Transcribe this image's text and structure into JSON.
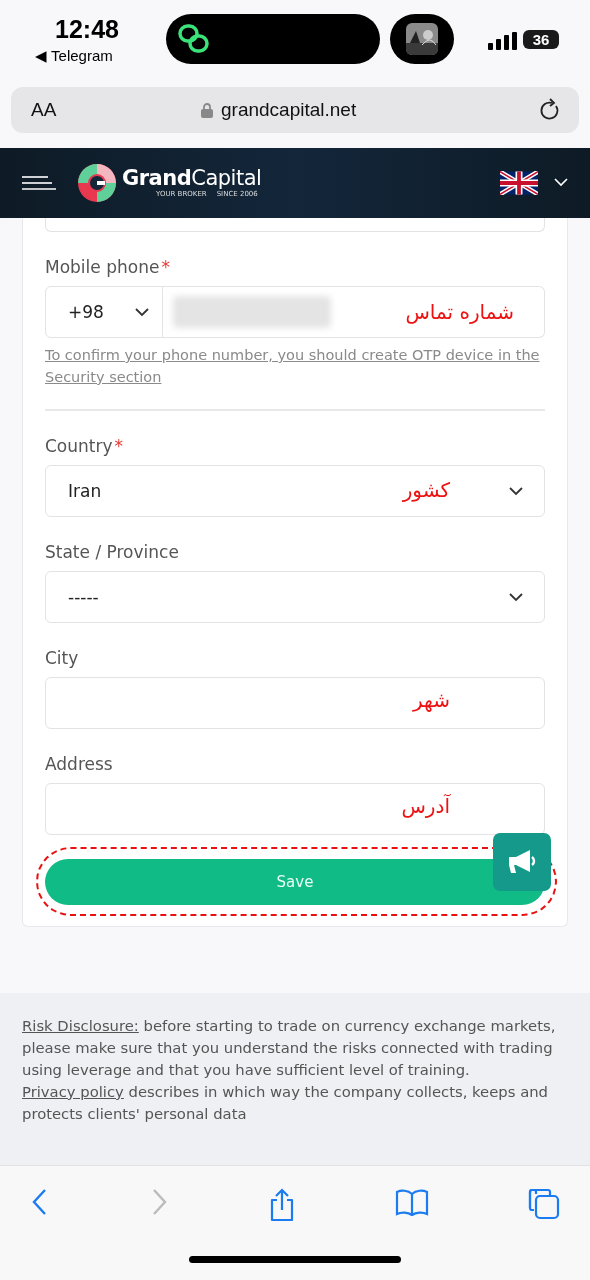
{
  "status_bar": {
    "time": "12:48",
    "back_app": "◀ Telegram",
    "battery": "36"
  },
  "browser": {
    "text_size": "AA",
    "url": "grandcapital.net"
  },
  "header": {
    "brand_bold": "Grand",
    "brand_regular": "Capital",
    "tagline_left": "YOUR BROKER",
    "tagline_right": "SINCE 2006"
  },
  "form": {
    "fields": [
      {
        "kind": "phone",
        "label": "Mobile phone",
        "required": true,
        "code": "+98",
        "annotation": "شماره تماس",
        "hint": "To confirm your phone number, you should create OTP device in the Security section"
      },
      {
        "kind": "select",
        "label": "Country",
        "required": true,
        "value": "Iran",
        "annotation": "کشور"
      },
      {
        "kind": "select",
        "label": "State / Province",
        "required": false,
        "value": "-----"
      },
      {
        "kind": "text",
        "label": "City",
        "required": false,
        "annotation": "شهر"
      },
      {
        "kind": "text",
        "label": "Address",
        "required": false,
        "annotation": "آدرس"
      }
    ],
    "required_mark": "*",
    "save_button": "Save"
  },
  "footer": {
    "risk_link": "Risk Disclosure:",
    "risk_text": " before starting to trade on currency exchange markets, please make sure that you understand the risks connected with trading using leverage and that you have sufficient level of training.",
    "privacy_link": "Privacy policy",
    "privacy_text": " describes in which way the company collects, keeps and protects clients' personal data"
  }
}
